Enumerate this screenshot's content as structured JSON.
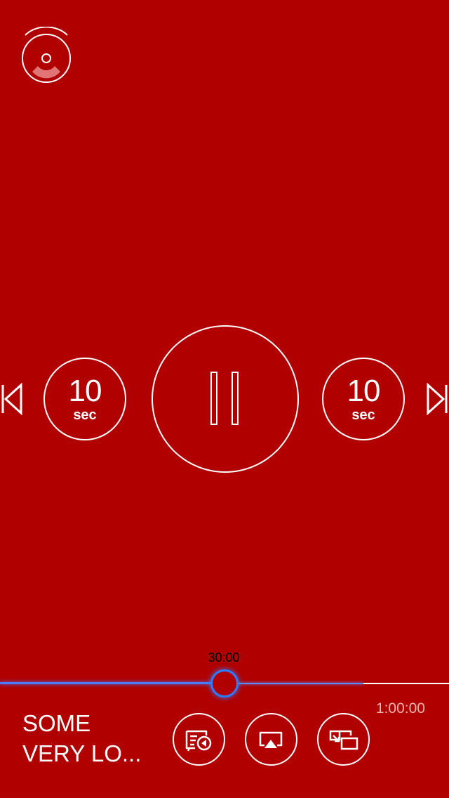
{
  "theme": {
    "background": "#b00000",
    "foreground": "#ffffff",
    "accent": "#2f7bff"
  },
  "top": {
    "disc_icon": "disc-cast-icon"
  },
  "controls": {
    "previous_icon": "skip-previous-icon",
    "skip_back": {
      "amount": "10",
      "unit": "sec"
    },
    "play_pause_icon": "pause-icon",
    "skip_forward": {
      "amount": "10",
      "unit": "sec"
    },
    "next_icon": "skip-next-icon"
  },
  "scrubber": {
    "current_time": "30:00",
    "duration": "1:00:00",
    "progress": 0.5,
    "buffered": 0.81
  },
  "track": {
    "title_line1": "SOME",
    "title_line2": "VERY LO..."
  },
  "actions": [
    {
      "icon": "playlist-icon"
    },
    {
      "icon": "airplay-icon"
    },
    {
      "icon": "picture-in-picture-icon"
    }
  ]
}
